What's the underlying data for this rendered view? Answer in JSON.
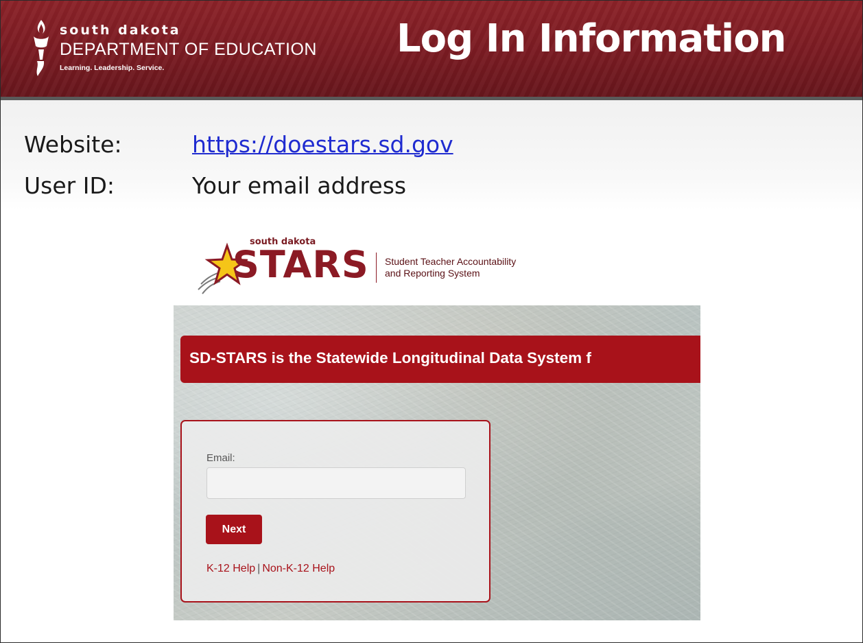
{
  "header": {
    "org_line1": "south dakota",
    "org_line2": "DEPARTMENT OF EDUCATION",
    "org_tagline": "Learning. Leadership. Service.",
    "title": "Log In Information",
    "logo_icon": "torch-icon"
  },
  "info": {
    "website_label": "Website:",
    "website_value": "https://doestars.sd.gov",
    "userid_label": "User ID:",
    "userid_value": "Your email address"
  },
  "stars_logo": {
    "small_text": "south dakota",
    "big_text": "STARS",
    "subtitle_line1": "Student Teacher Accountability",
    "subtitle_line2": "and Reporting System",
    "icon": "star-icon"
  },
  "login": {
    "banner_text": "SD-STARS is the Statewide Longitudinal Data System f",
    "email_label": "Email:",
    "email_value": "",
    "next_label": "Next",
    "help_k12": "K-12 Help",
    "help_sep": "|",
    "help_non_k12": "Non-K-12 Help"
  },
  "colors": {
    "banner_red": "#7a1b22",
    "stars_red": "#a8121a",
    "link_blue": "#1f2bd0"
  }
}
